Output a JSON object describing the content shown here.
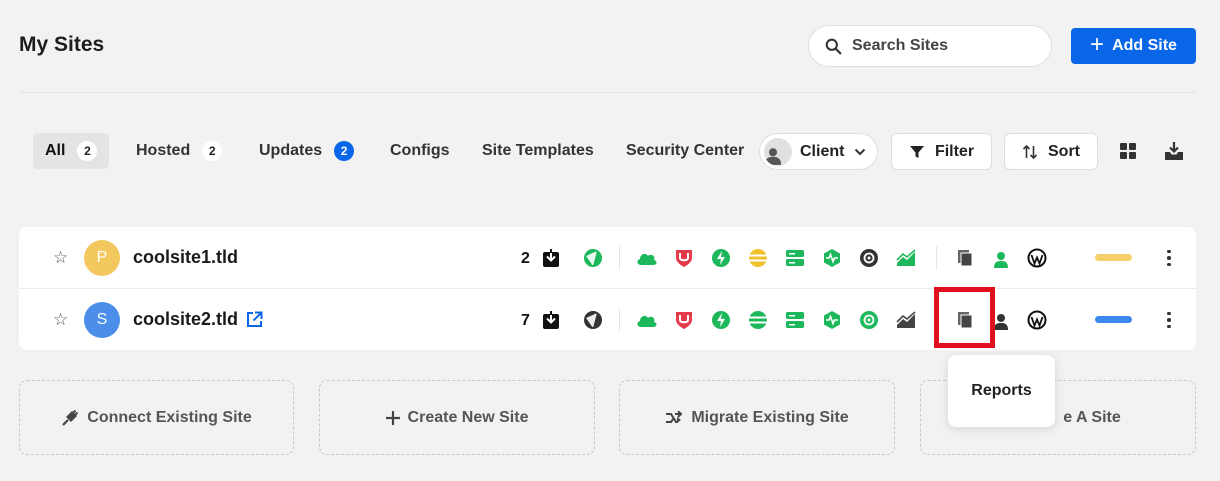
{
  "header": {
    "title": "My Sites",
    "search_placeholder": "Search Sites",
    "add_site_label": "Add Site"
  },
  "tabs": [
    {
      "label": "All",
      "count": "2",
      "active": true
    },
    {
      "label": "Hosted",
      "count": "2"
    },
    {
      "label": "Updates",
      "count": "2"
    },
    {
      "label": "Configs"
    },
    {
      "label": "Site Templates"
    },
    {
      "label": "Security Center"
    }
  ],
  "toolbar": {
    "client_label": "Client",
    "filter_label": "Filter",
    "sort_label": "Sort"
  },
  "sites": [
    {
      "avatar_letter": "P",
      "avatar_color": "#f3c95f",
      "name": "coolsite1.tld",
      "updates": "2",
      "status_color": "#f5cf6a"
    },
    {
      "avatar_letter": "S",
      "avatar_color": "#4a8ee9",
      "name": "coolsite2.tld",
      "updates": "7",
      "status_color": "#3b88f0"
    }
  ],
  "actions": [
    {
      "label": "Connect Existing Site",
      "icon": "plug-icon"
    },
    {
      "label": "Create New Site",
      "icon": "plus-icon"
    },
    {
      "label": "Migrate Existing Site",
      "icon": "migrate-icon"
    },
    {
      "label": "e A Site",
      "icon": ""
    }
  ],
  "tooltip": {
    "label": "Reports"
  },
  "colors": {
    "accent": "#0a66e8",
    "green": "#1eb85c",
    "red": "#e33b4a",
    "highlight": "#e0101e"
  }
}
